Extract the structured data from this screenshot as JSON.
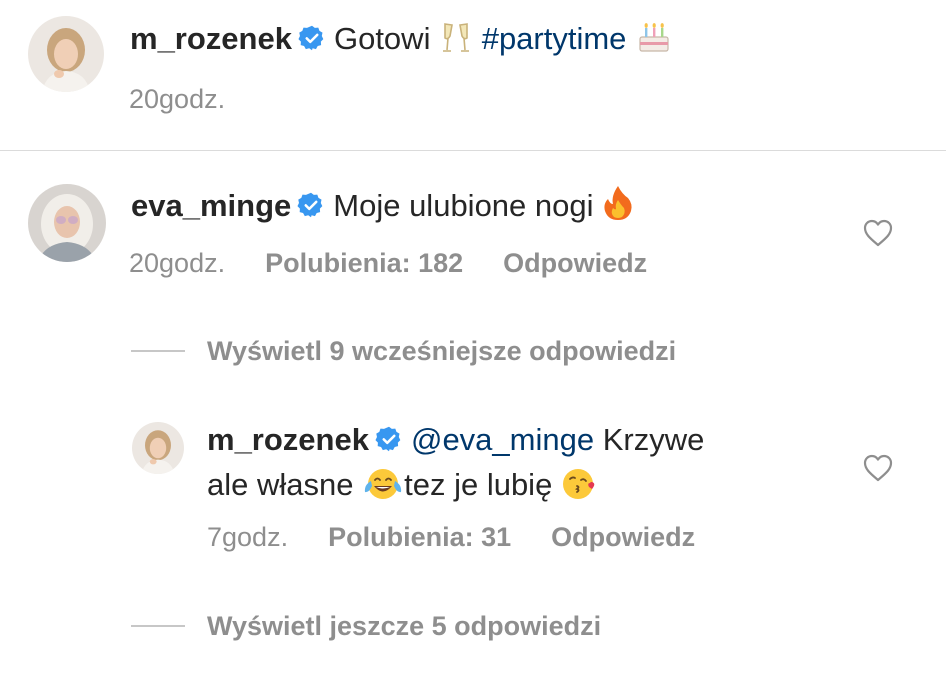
{
  "caption": {
    "username": "m_rozenek",
    "text_before": "Gotowi",
    "hashtag": "#partytime",
    "time": "20godz."
  },
  "comments": [
    {
      "username": "eva_minge",
      "text": "Moje ulubione nogi",
      "time": "20godz.",
      "likes": "Polubienia: 182",
      "reply": "Odpowiedz"
    }
  ],
  "view_earlier": "Wyświetl 9 wcześniejsze odpowiedzi",
  "reply": {
    "username": "m_rozenek",
    "mention": "@eva_minge",
    "text_line1_end": "Krzywe",
    "text_line2_a": "ale własne",
    "text_line2_b": "tez je lubię",
    "time": "7godz.",
    "likes": "Polubienia: 31",
    "reply_label": "Odpowiedz"
  },
  "view_more": "Wyświetl jeszcze 5 odpowiedzi",
  "icons": {
    "verified": "verified-badge-icon",
    "like": "heart-outline-icon",
    "emoji_champagne": "clinking-glasses-emoji",
    "emoji_cake": "birthday-cake-emoji",
    "emoji_fire": "fire-emoji",
    "emoji_laugh": "tears-of-joy-emoji",
    "emoji_kiss": "face-blowing-kiss-emoji"
  },
  "colors": {
    "text": "#262626",
    "secondary": "#8e8e8e",
    "link": "#00376b",
    "verified": "#3897f0"
  }
}
